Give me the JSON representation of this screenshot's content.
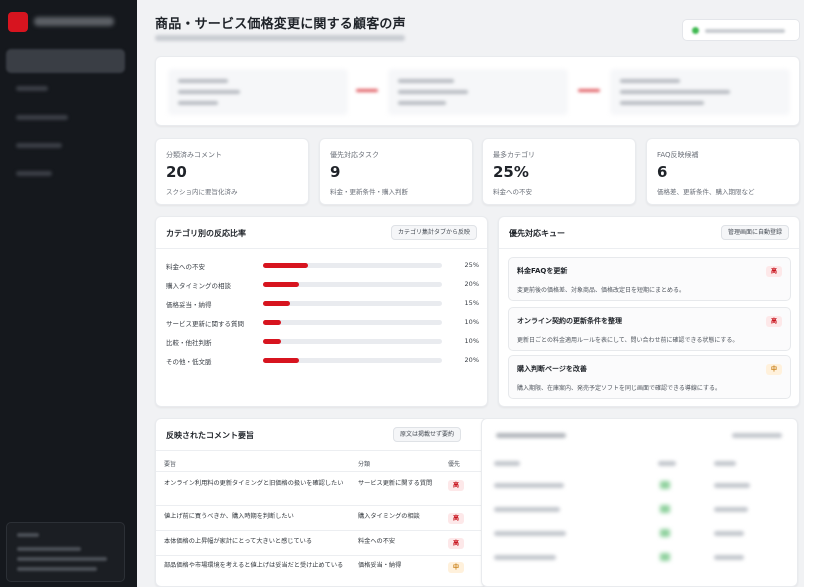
{
  "page": {
    "title": "商品・サービス価格変更に関する顧客の声"
  },
  "kpis": [
    {
      "label": "分類済みコメント",
      "value": "20",
      "note": "スクショ内に要旨化済み"
    },
    {
      "label": "優先対応タスク",
      "value": "9",
      "note": "料金・更新条件・購入判断"
    },
    {
      "label": "最多カテゴリ",
      "value": "25%",
      "note": "料金への不安"
    },
    {
      "label": "FAQ反映候補",
      "value": "6",
      "note": "価格差、更新条件、購入期限など"
    }
  ],
  "category_panel": {
    "title": "カテゴリ別の反応比率",
    "action": "カテゴリ集計タブから反映",
    "rows": [
      {
        "name": "料金への不安",
        "pct": "25%",
        "ratio": 0.25
      },
      {
        "name": "購入タイミングの相談",
        "pct": "20%",
        "ratio": 0.2
      },
      {
        "name": "価格妥当・納得",
        "pct": "15%",
        "ratio": 0.15
      },
      {
        "name": "サービス更新に関する質問",
        "pct": "10%",
        "ratio": 0.1
      },
      {
        "name": "比較・他社判断",
        "pct": "10%",
        "ratio": 0.1
      },
      {
        "name": "その他・低文脈",
        "pct": "20%",
        "ratio": 0.2
      }
    ]
  },
  "queue_panel": {
    "title": "優先対応キュー",
    "action": "管理画面に自動登録",
    "items": [
      {
        "title": "料金FAQを更新",
        "desc": "変更前後の価格差、対象商品、価格改定日を短期にまとめる。",
        "badge": "高",
        "level": "high"
      },
      {
        "title": "オンライン契約の更新条件を整理",
        "desc": "更新日ごとの料金適用ルールを表にして、問い合わせ前に確認できる状態にする。",
        "badge": "高",
        "level": "high"
      },
      {
        "title": "購入判断ページを改善",
        "desc": "購入期限、在庫案内、発売予定ソフトを同じ画面で確認できる導線にする。",
        "badge": "中",
        "level": "mid"
      }
    ]
  },
  "comment_panel": {
    "title": "反映されたコメント要旨",
    "action": "原文は掲載せず要約",
    "headers": {
      "summary": "要旨",
      "category": "分類",
      "priority": "優先"
    },
    "rows": [
      {
        "summary": "オンライン利用料の更新タイミングと旧価格の扱いを確認したい",
        "category": "サービス更新に関する質問",
        "badge": "高",
        "level": "high"
      },
      {
        "summary": "値上げ前に買うべきか、購入時期を判断したい",
        "category": "購入タイミングの相談",
        "badge": "高",
        "level": "high"
      },
      {
        "summary": "本体価格の上昇幅が家計にとって大きいと感じている",
        "category": "料金への不安",
        "badge": "高",
        "level": "high"
      },
      {
        "summary": "部品価格や市場環境を考えると値上げは妥当だと受け止めている",
        "category": "価格妥当・納得",
        "badge": "中",
        "level": "mid"
      }
    ]
  },
  "colors": {
    "accent": "#d7141f",
    "sidebar": "#15181d",
    "background": "#f1f2f4",
    "badge_high_bg": "#fde8e9",
    "badge_mid_bg": "#fff1dc"
  }
}
